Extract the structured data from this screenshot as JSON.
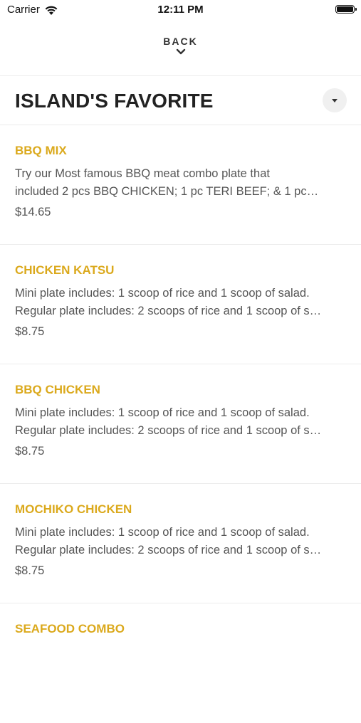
{
  "status_bar": {
    "carrier": "Carrier",
    "time": "12:11 PM"
  },
  "navigation": {
    "back_label": "BACK"
  },
  "category": {
    "title": "ISLAND'S FAVORITE"
  },
  "menu_items": [
    {
      "name": "BBQ MIX",
      "desc_line1": "Try our Most famous BBQ meat combo plate that",
      "desc_line2": "included 2 pcs BBQ CHICKEN; 1 pc TERI BEEF; & 1 pc…",
      "price": "$14.65"
    },
    {
      "name": "CHICKEN KATSU",
      "desc_line1": "Mini plate includes: 1 scoop of rice and 1 scoop of salad.",
      "desc_line2": "Regular plate includes: 2 scoops of rice and 1 scoop of s…",
      "price": "$8.75"
    },
    {
      "name": "BBQ CHICKEN",
      "desc_line1": "Mini plate includes: 1 scoop of rice and 1 scoop of salad.",
      "desc_line2": "Regular plate includes: 2 scoops of rice and 1 scoop of s…",
      "price": "$8.75"
    },
    {
      "name": "MOCHIKO CHICKEN",
      "desc_line1": "Mini plate includes: 1 scoop of rice and 1 scoop of salad.",
      "desc_line2": "Regular plate includes: 2 scoops of rice and 1 scoop of s…",
      "price": "$8.75"
    },
    {
      "name": "SEAFOOD COMBO"
    }
  ],
  "colors": {
    "item_name": "#dba91c",
    "text_secondary": "#555555",
    "divider": "#ececec"
  },
  "icons": {
    "wifi": "wifi-icon",
    "battery": "battery-icon",
    "back": "chevron-down-icon",
    "dropdown": "caret-down-icon"
  }
}
